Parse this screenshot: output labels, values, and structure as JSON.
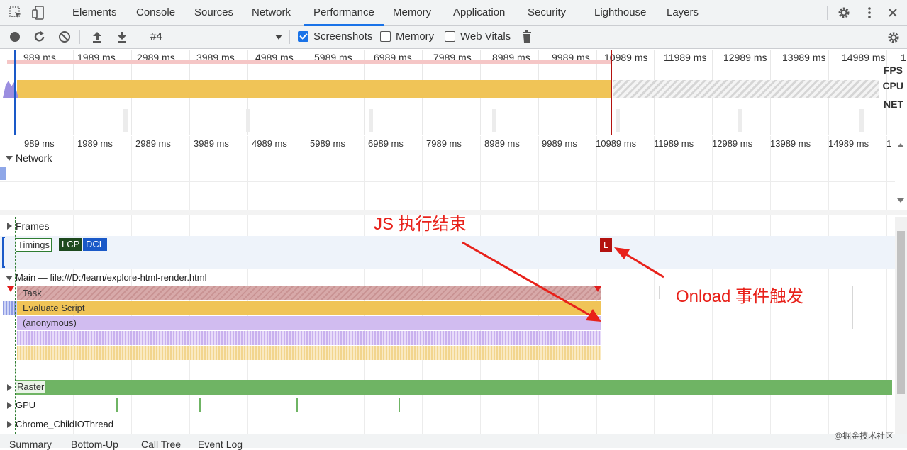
{
  "tabs": [
    "Elements",
    "Console",
    "Sources",
    "Network",
    "Performance",
    "Memory",
    "Application",
    "Security",
    "Lighthouse",
    "Layers"
  ],
  "active_tab": "Performance",
  "toolbar": {
    "profile_select": "#4",
    "screenshots_label": "Screenshots",
    "screenshots_checked": true,
    "memory_label": "Memory",
    "memory_checked": false,
    "webvitals_label": "Web Vitals",
    "webvitals_checked": false
  },
  "overview": {
    "ticks": [
      "989 ms",
      "1989 ms",
      "2989 ms",
      "3989 ms",
      "4989 ms",
      "5989 ms",
      "6989 ms",
      "7989 ms",
      "8989 ms",
      "9989 ms",
      "10989 ms",
      "11989 ms",
      "12989 ms",
      "13989 ms",
      "14989 ms",
      "1"
    ],
    "fps_label": "FPS",
    "cpu_label": "CPU",
    "net_label": "NET"
  },
  "timeline_ticks": [
    "989 ms",
    "1989 ms",
    "2989 ms",
    "3989 ms",
    "4989 ms",
    "5989 ms",
    "6989 ms",
    "7989 ms",
    "8989 ms",
    "9989 ms",
    "10989 ms",
    "11989 ms",
    "12989 ms",
    "13989 ms",
    "14989 ms",
    "1"
  ],
  "tracks": {
    "network": "Network",
    "frames": "Frames",
    "timings": "Timings",
    "lcp": "LCP",
    "dcl": "DCL",
    "load_marker": "L",
    "main": "Main — file:///D:/learn/explore-html-render.html",
    "task": "Task",
    "evaluate_script": "Evaluate Script",
    "anonymous": "(anonymous)",
    "raster": "Raster",
    "gpu": "GPU",
    "child_io": "Chrome_ChildIOThread"
  },
  "annotations": {
    "js_end": "JS 执行结束",
    "onload": "Onload 事件触发"
  },
  "bottom_tabs": [
    "Summary",
    "Bottom-Up",
    "Call Tree",
    "Event Log"
  ],
  "watermark": "@掘金技术社区",
  "colors": {
    "accent": "#1a73e8",
    "cpu_scripting": "#f0c457",
    "task_red": "#d6a6a6",
    "anonymous_purple": "#d1bcf0",
    "raster_green": "#6fb464",
    "load_red": "#b3120f",
    "annotation": "#e8211a"
  }
}
